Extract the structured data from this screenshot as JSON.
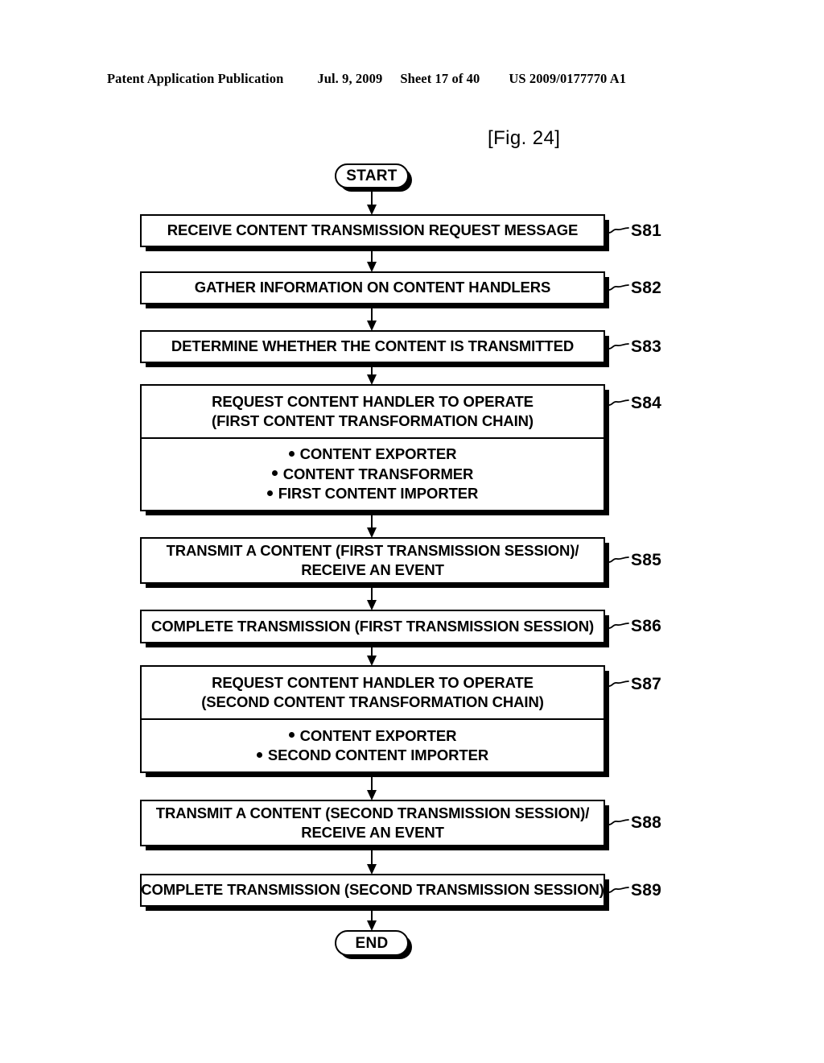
{
  "header": {
    "publication": "Patent Application Publication",
    "date": "Jul. 9, 2009",
    "sheet": "Sheet 17 of 40",
    "patent_number": "US 2009/0177770 A1"
  },
  "figure": {
    "caption": "[Fig. 24]"
  },
  "flow": {
    "start": {
      "label": "START"
    },
    "end": {
      "label": "END"
    },
    "steps": [
      {
        "ref": "S81",
        "lines": [
          "RECEIVE CONTENT TRANSMISSION REQUEST MESSAGE"
        ],
        "bullets": []
      },
      {
        "ref": "S82",
        "lines": [
          "GATHER INFORMATION ON CONTENT HANDLERS"
        ],
        "bullets": []
      },
      {
        "ref": "S83",
        "lines": [
          "DETERMINE WHETHER THE CONTENT IS TRANSMITTED"
        ],
        "bullets": []
      },
      {
        "ref": "S84",
        "lines": [
          "REQUEST CONTENT HANDLER TO OPERATE",
          "(FIRST CONTENT TRANSFORMATION CHAIN)"
        ],
        "bullets": [
          "CONTENT EXPORTER",
          "CONTENT TRANSFORMER",
          "FIRST CONTENT IMPORTER"
        ]
      },
      {
        "ref": "S85",
        "lines": [
          "TRANSMIT A CONTENT (FIRST TRANSMISSION SESSION)/",
          "RECEIVE AN EVENT"
        ],
        "bullets": []
      },
      {
        "ref": "S86",
        "lines": [
          "COMPLETE TRANSMISSION (FIRST TRANSMISSION SESSION)"
        ],
        "bullets": []
      },
      {
        "ref": "S87",
        "lines": [
          "REQUEST CONTENT HANDLER TO OPERATE",
          "(SECOND CONTENT TRANSFORMATION CHAIN)"
        ],
        "bullets": [
          "CONTENT EXPORTER",
          "SECOND CONTENT IMPORTER"
        ]
      },
      {
        "ref": "S88",
        "lines": [
          "TRANSMIT A CONTENT (SECOND TRANSMISSION SESSION)/",
          "RECEIVE AN EVENT"
        ],
        "bullets": []
      },
      {
        "ref": "S89",
        "lines": [
          "COMPLETE TRANSMISSION (SECOND TRANSMISSION SESSION)"
        ],
        "bullets": []
      }
    ]
  },
  "style": {
    "ink": "#000000",
    "paper": "#ffffff"
  }
}
